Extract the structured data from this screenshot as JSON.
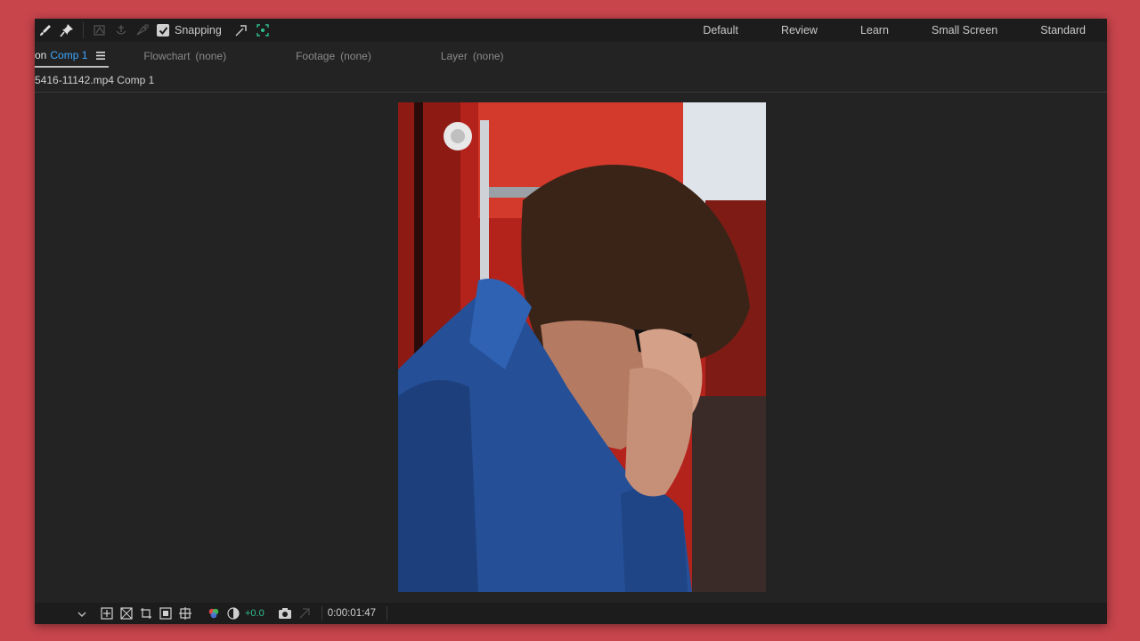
{
  "toolbar": {
    "snapping_label": "Snapping",
    "snapping_checked": true,
    "tool_icons": [
      "paintbrush-icon",
      "puppet-pin-icon",
      "shape-tool-icon",
      "anchor-tool-icon",
      "pen-tool-icon",
      "snap-edge-icon",
      "snap-grid-icon"
    ]
  },
  "workspaces": [
    "Default",
    "Review",
    "Learn",
    "Small Screen",
    "Standard"
  ],
  "tabs": {
    "composition_prefix": "on",
    "composition_name": "Comp 1",
    "flowchart_label": "Flowchart",
    "flowchart_value": "(none)",
    "footage_label": "Footage",
    "footage_value": "(none)",
    "layer_label": "Layer",
    "layer_value": "(none)"
  },
  "breadcrumb": "5416-11142.mp4 Comp 1",
  "bottom_bar": {
    "exposure": "+0.0",
    "timecode": "0:00:01:47"
  },
  "colors": {
    "background": "#c8454c",
    "panel": "#232323",
    "accent_blue": "#3ea8ff",
    "exposure_green": "#2fbf8f"
  }
}
